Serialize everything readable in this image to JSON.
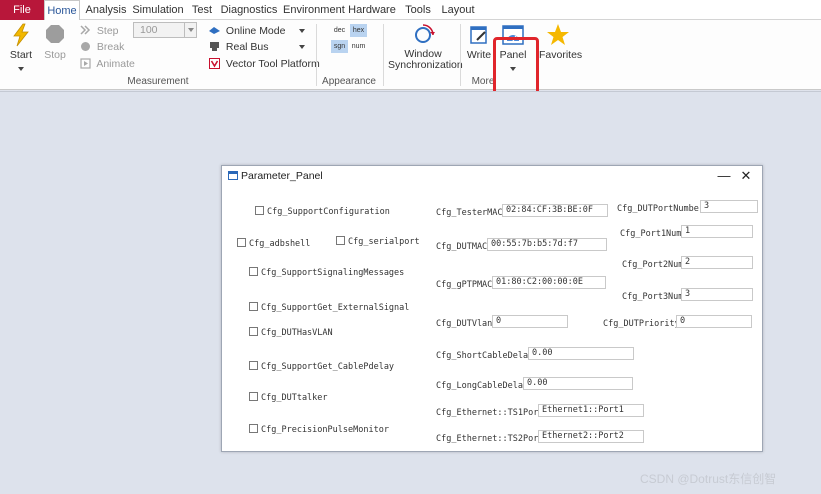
{
  "tabs": [
    "File",
    "Home",
    "Analysis",
    "Simulation",
    "Test",
    "Diagnostics",
    "Environment",
    "Hardware",
    "Tools",
    "Layout"
  ],
  "measurement": {
    "start": "Start",
    "stop": "Stop",
    "step": "Step",
    "break": "Break",
    "animate": "Animate",
    "combo_value": "100",
    "online_mode": "Online Mode",
    "real_bus": "Real Bus",
    "vector_tool_platform": "Vector Tool Platform",
    "group_label": "Measurement"
  },
  "appearance": {
    "dec": "dec",
    "hex": "hex",
    "sgn": "sgn",
    "num": "num",
    "group_label": "Appearance"
  },
  "window_sync": {
    "line1": "Window",
    "line2": "Synchronization"
  },
  "more": {
    "write": "Write",
    "panel": "Panel",
    "favorites": "Favorites",
    "group_label": "More"
  },
  "icons": {
    "start": "lightning-icon",
    "stop": "stop-octagon-icon",
    "step": "step-icon",
    "break": "break-icon",
    "animate": "animate-icon",
    "online": "online-mode-icon",
    "realbus": "real-bus-icon",
    "vtp": "vector-tool-platform-icon",
    "winsync": "window-sync-icon",
    "write": "write-icon",
    "panel": "panel-gauge-icon",
    "favorites": "star-icon"
  },
  "colors": {
    "file_tab": "#b8173a",
    "highlight": "#e0252b",
    "accent": "#2b579a",
    "start": "#f2b800",
    "star": "#f5b800"
  },
  "panel": {
    "title": "Parameter_Panel",
    "minimize": "—",
    "close": "✕",
    "checkboxes": [
      "Cfg_SupportConfiguration",
      "Cfg_adbshell",
      "Cfg_serialport",
      "Cfg_SupportSignalingMessages",
      "Cfg_SupportGet_ExternalSignal",
      "Cfg_DUTHasVLAN",
      "Cfg_SupportGet_CablePdelay",
      "Cfg_DUTtalker",
      "Cfg_PrecisionPulseMonitor"
    ],
    "fields": [
      {
        "label": "Cfg_TesterMAC:",
        "value": "02:84:CF:3B:BE:0F"
      },
      {
        "label": "Cfg_DUTMAC:",
        "value": "00:55:7b:b5:7d:f7"
      },
      {
        "label": "Cfg_gPTPMAC:",
        "value": "01:80:C2:00:00:0E"
      },
      {
        "label": "Cfg_DUTVlan:",
        "value": "0"
      },
      {
        "label": "Cfg_ShortCableDelay:",
        "value": "0.00"
      },
      {
        "label": "Cfg_LongCableDelay:",
        "value": "0.00"
      },
      {
        "label": "Cfg_Ethernet::TS1Port:",
        "value": "Ethernet1::Port1"
      },
      {
        "label": "Cfg_Ethernet::TS2Port:",
        "value": "Ethernet2::Port2"
      }
    ],
    "right_fields": [
      {
        "label": "Cfg_DUTPortNumber:",
        "value": "3"
      },
      {
        "label": "Cfg_Port1Num:",
        "value": "1"
      },
      {
        "label": "Cfg_Port2Num:",
        "value": "2"
      },
      {
        "label": "Cfg_Port3Num:",
        "value": "3"
      },
      {
        "label": "Cfg_DUTPriority:",
        "value": "0"
      }
    ]
  },
  "watermark": "CSDN @Dotrust东信创智"
}
